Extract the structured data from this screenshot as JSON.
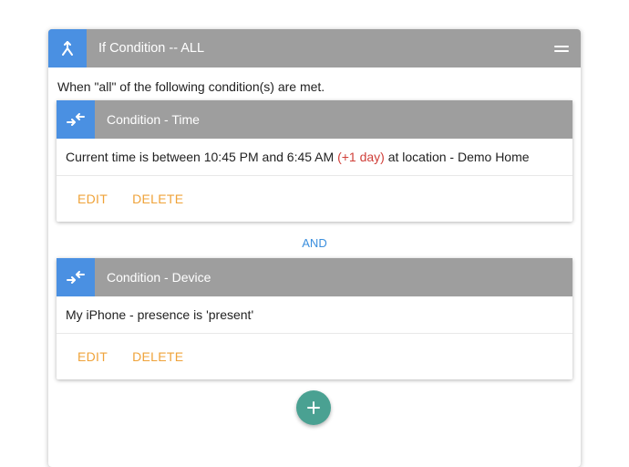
{
  "group": {
    "title": "If Condition -- ALL",
    "intro": "When \"all\" of the following condition(s) are met."
  },
  "conditions": [
    {
      "title": "Condition - Time",
      "description_parts": [
        "Current time is between 10:45 PM and 6:45 AM",
        "(+1 day)",
        "at location - Demo Home"
      ],
      "edit_label": "EDIT",
      "delete_label": "DELETE"
    },
    {
      "title": "Condition - Device",
      "description_parts": [
        "My iPhone - presence is 'present'"
      ],
      "edit_label": "EDIT",
      "delete_label": "DELETE"
    }
  ],
  "joiner": "AND",
  "icons": {
    "header": "merge-icon",
    "condition": "swap-arrows-icon",
    "menu": "menu-icon",
    "add": "add-icon"
  },
  "colors": {
    "header_gray": "#9e9e9e",
    "icon_blue": "#4a90e2",
    "action_orange": "#efa33a",
    "highlight_red": "#d0403a",
    "and_blue": "#3b8fde",
    "fab_teal": "#4aa192"
  }
}
